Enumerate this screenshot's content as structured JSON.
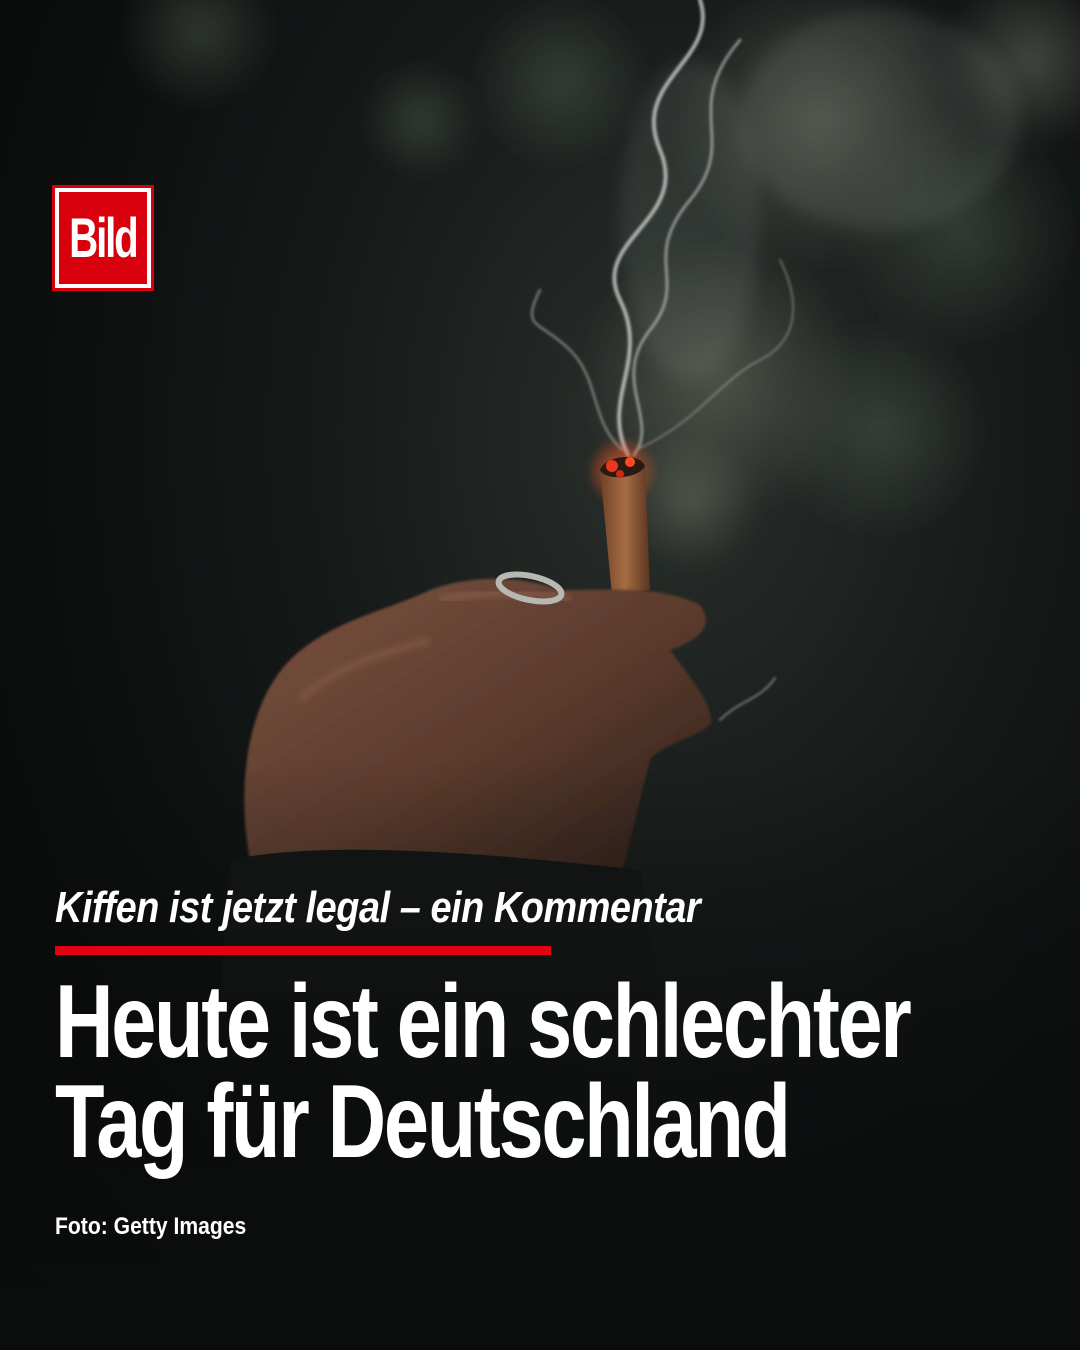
{
  "brand": {
    "logo_text": "Bild",
    "brand_color": "#d9000d"
  },
  "post": {
    "kicker": "Kiffen ist jetzt legal – ein Kommentar",
    "headline_line_1": "Heute ist ein schlechter",
    "headline_line_2": "Tag für Deutschland",
    "credit": "Foto: Getty Images"
  },
  "colors": {
    "accent_rule": "#e3000f",
    "text": "#ffffff",
    "background": "#0b0d0d"
  },
  "image": {
    "subject": "hand-holding-lit-joint-with-smoke"
  }
}
